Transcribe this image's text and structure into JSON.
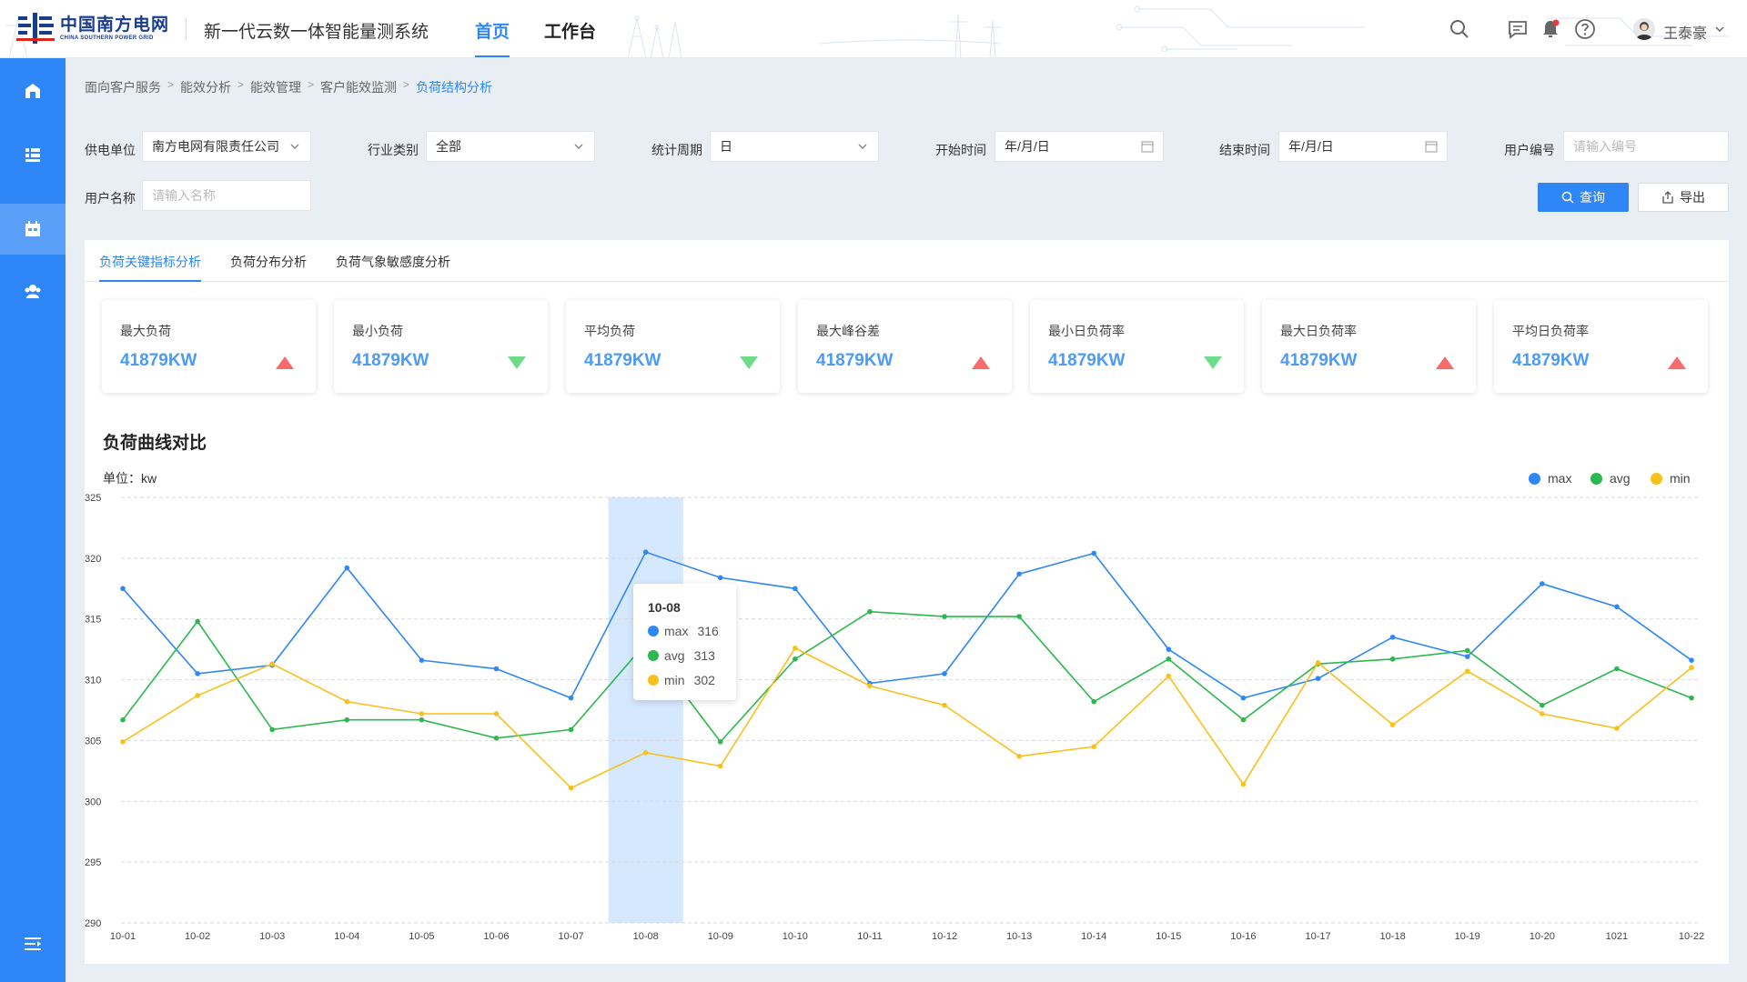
{
  "brand": {
    "logo_cn": "中国南方电网",
    "logo_en": "CHINA SOUTHERN POWER GRID",
    "system_title": "新一代云数一体智能量测系统"
  },
  "nav": {
    "tabs": [
      {
        "label": "首页",
        "active": true
      },
      {
        "label": "工作台",
        "active": false
      }
    ]
  },
  "user": {
    "name": "王泰豪"
  },
  "breadcrumb": [
    "面向客户服务",
    "能效分析",
    "能效管理",
    "客户能效监测",
    "负荷结构分析"
  ],
  "filters": {
    "supplier": {
      "label": "供电单位",
      "value": "南方电网有限责任公司"
    },
    "industry": {
      "label": "行业类别",
      "value": "全部"
    },
    "period": {
      "label": "统计周期",
      "value": "日"
    },
    "start": {
      "label": "开始时间",
      "value": "年/月/日"
    },
    "end": {
      "label": "结束时间",
      "value": "年/月/日"
    },
    "user_no": {
      "label": "用户编号",
      "placeholder": "请输入编号"
    },
    "user_name": {
      "label": "用户名称",
      "placeholder": "请输入名称"
    },
    "query_label": "查询",
    "export_label": "导出"
  },
  "tabs": [
    {
      "label": "负荷关键指标分析",
      "active": true
    },
    {
      "label": "负荷分布分析",
      "active": false
    },
    {
      "label": "负荷气象敏感度分析",
      "active": false
    }
  ],
  "kpis": [
    {
      "label": "最大负荷",
      "value": "41879KW",
      "trend": "up"
    },
    {
      "label": "最小负荷",
      "value": "41879KW",
      "trend": "down"
    },
    {
      "label": "平均负荷",
      "value": "41879KW",
      "trend": "down"
    },
    {
      "label": "最大峰谷差",
      "value": "41879KW",
      "trend": "up"
    },
    {
      "label": "最小日负荷率",
      "value": "41879KW",
      "trend": "down"
    },
    {
      "label": "最大日负荷率",
      "value": "41879KW",
      "trend": "up"
    },
    {
      "label": "平均日负荷率",
      "value": "41879KW",
      "trend": "up"
    }
  ],
  "colors": {
    "accent": "#2f86f6",
    "up": "#f86b6b",
    "down": "#6fdc8c",
    "max": "#2f86f6",
    "avg": "#2db84d",
    "min": "#f7c11c"
  },
  "chart_data": {
    "type": "line",
    "title": "负荷曲线对比",
    "ylabel": "单位：kw",
    "xlabel": "",
    "ylim": [
      290,
      325
    ],
    "yticks": [
      290,
      295,
      300,
      305,
      310,
      315,
      320,
      325
    ],
    "grid": true,
    "legend": "top-right",
    "categories": [
      "10-01",
      "10-02",
      "10-03",
      "10-04",
      "10-05",
      "10-06",
      "10-07",
      "10-08",
      "10-09",
      "10-10",
      "10-11",
      "10-12",
      "10-13",
      "10-14",
      "10-15",
      "10-16",
      "10-17",
      "10-18",
      "10-19",
      "10-20",
      "1021",
      "10-22"
    ],
    "series": [
      {
        "name": "max",
        "values": [
          317.5,
          310.5,
          311.2,
          319.2,
          311.6,
          310.9,
          308.5,
          320.5,
          318.4,
          317.5,
          309.7,
          310.5,
          318.7,
          320.4,
          312.5,
          308.5,
          310.1,
          313.5,
          311.9,
          317.9,
          316.0,
          311.6
        ]
      },
      {
        "name": "avg",
        "values": [
          306.7,
          314.8,
          305.9,
          306.7,
          306.7,
          305.2,
          305.9,
          313.0,
          304.9,
          311.7,
          315.6,
          315.2,
          315.2,
          308.2,
          311.7,
          306.7,
          311.3,
          311.7,
          312.4,
          307.9,
          310.9,
          308.5
        ]
      },
      {
        "name": "min",
        "values": [
          304.9,
          308.7,
          311.3,
          308.2,
          307.2,
          307.2,
          301.1,
          304.0,
          302.9,
          312.6,
          309.5,
          307.9,
          303.7,
          304.5,
          310.3,
          301.4,
          311.4,
          306.3,
          310.7,
          307.2,
          306.0,
          311.0
        ]
      }
    ],
    "highlight": {
      "category": "10-08"
    },
    "tooltip": {
      "title": "10-08",
      "rows": [
        {
          "name": "max",
          "value": "316"
        },
        {
          "name": "avg",
          "value": "313"
        },
        {
          "name": "min",
          "value": "302"
        }
      ]
    }
  }
}
